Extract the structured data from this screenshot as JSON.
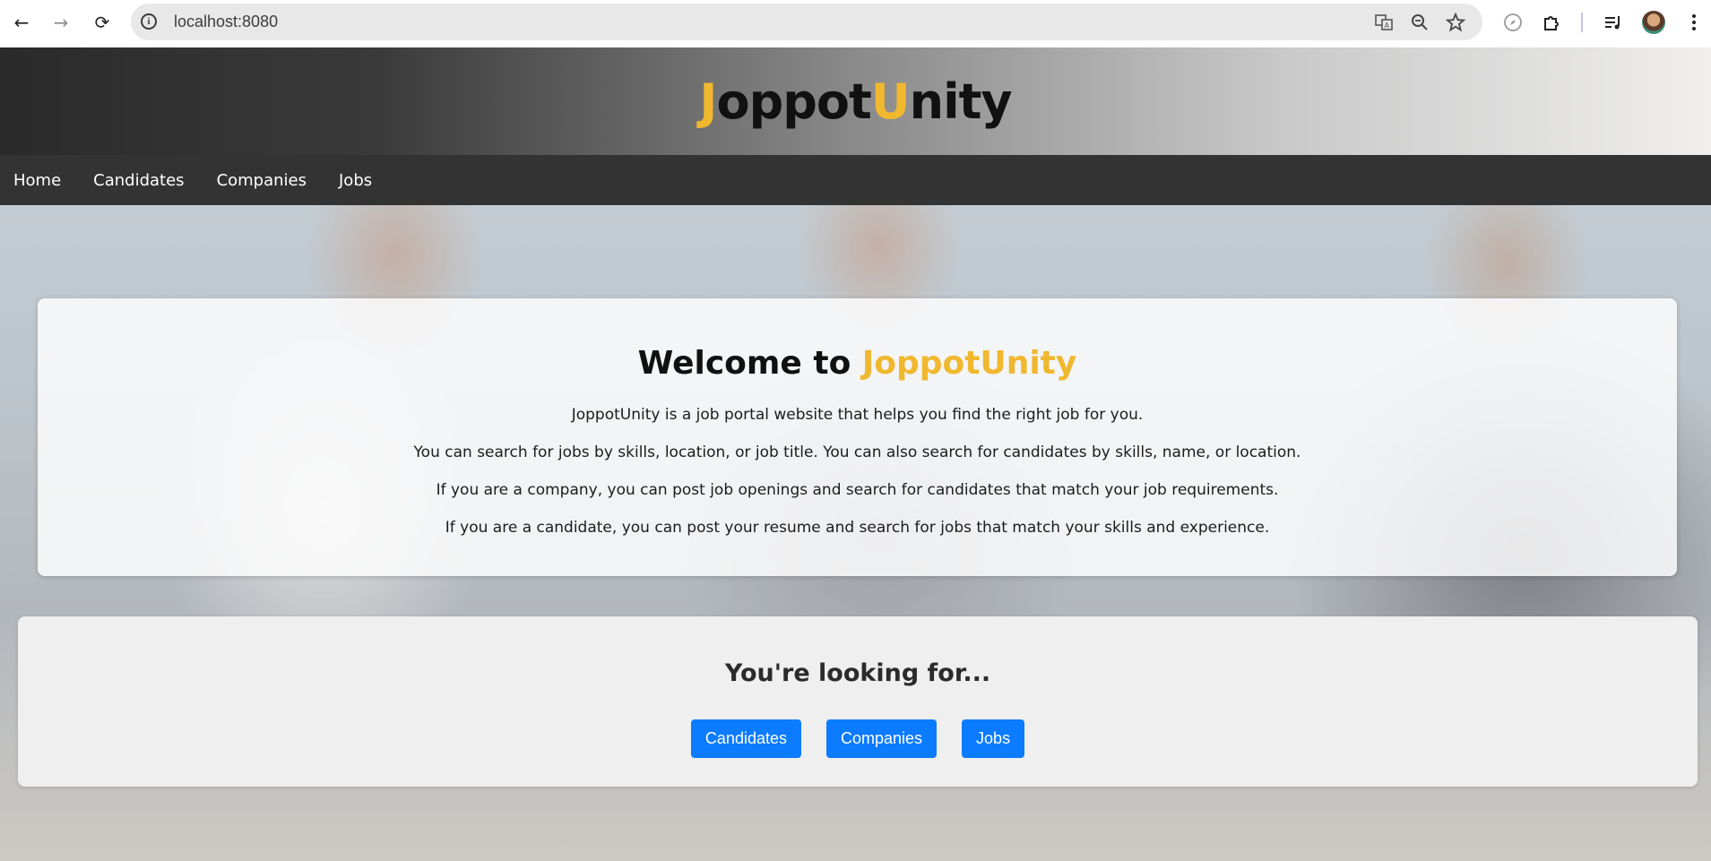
{
  "browser": {
    "url": "localhost:8080"
  },
  "site": {
    "logo_j": "J",
    "logo_oppot": "oppot",
    "logo_u": "U",
    "logo_nity": "nity"
  },
  "nav": {
    "items": [
      {
        "label": "Home"
      },
      {
        "label": "Candidates"
      },
      {
        "label": "Companies"
      },
      {
        "label": "Jobs"
      }
    ]
  },
  "welcome": {
    "title_prefix": "Welcome to",
    "title_brand": "JoppotUnity",
    "paragraphs": [
      "JoppotUnity is a job portal website that helps you find the right job for you.",
      "You can search for jobs by skills, location, or job title. You can also search for candidates by skills, name, or location.",
      "If you are a company, you can post job openings and search for candidates that match your job requirements.",
      "If you are a candidate, you can post your resume and search for jobs that match your skills and experience."
    ]
  },
  "lookup": {
    "title": "You're looking for...",
    "buttons": [
      {
        "label": "Candidates"
      },
      {
        "label": "Companies"
      },
      {
        "label": "Jobs"
      }
    ]
  },
  "colors": {
    "accent": "#f0b82e",
    "button": "#0b7bff",
    "navbar": "#333333"
  }
}
